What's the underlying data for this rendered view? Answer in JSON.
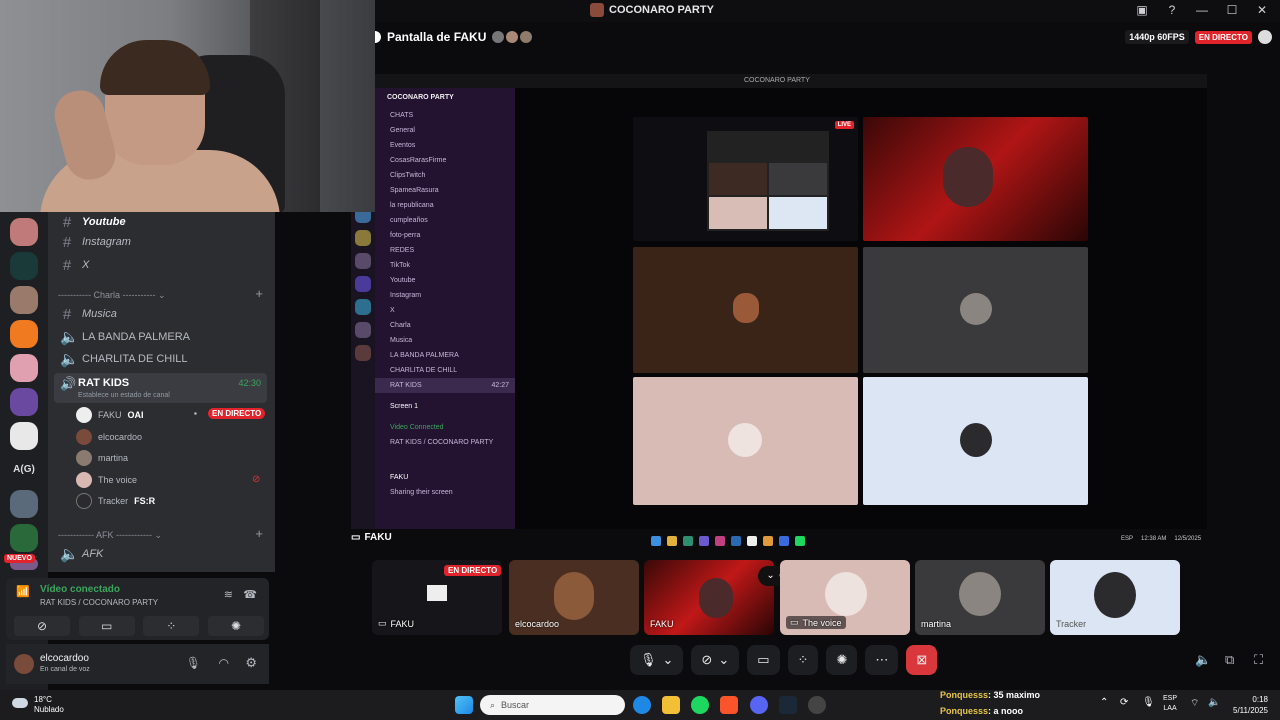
{
  "window": {
    "title": "COCONARO PARTY",
    "stream_title": "Pantalla de FAKU",
    "quality": "1440p 60FPS",
    "live_badge": "EN DIRECTO"
  },
  "inner_screen": {
    "title": "COCONARO PARTY",
    "server_name": "COCONARO PARTY",
    "channels": [
      "CHATS",
      "General",
      "Eventos",
      "CosasRarasFirme",
      "ClipsTwitch",
      "SpameaRasura",
      "la republicana",
      "cumpleaños",
      "foto-perra",
      "REDES",
      "TikTok",
      "Youtube",
      "Instagram",
      "X",
      "Charla",
      "Musica",
      "LA BANDA PALMERA",
      "CHARLITA DE CHILL",
      "RAT KIDS",
      "Screen 1",
      "Video Connected",
      "RAT KIDS / COCONARO PARTY",
      "FAKU",
      "Sharing their screen"
    ],
    "rat_kids_time": "42:27",
    "bottom_label": "FAKU",
    "tile_live": "LIVE",
    "tray_lang": "ESP",
    "tray_time": "12:38 AM",
    "tray_date": "12/5/2025"
  },
  "sidebar": {
    "channels": {
      "youtube": "Youtube",
      "instagram": "Instagram",
      "x": "X",
      "charla_category": "Charla",
      "musica": "Musica",
      "banda": "LA BANDA PALMERA",
      "charlita": "CHARLITA DE CHILL",
      "ratkids": "RAT KIDS",
      "ratkids_time": "42:30",
      "ratkids_status": "Establece un estado de canal",
      "afk_category": "AFK",
      "afk": "AFK"
    },
    "users": [
      {
        "name": "FAKU",
        "tag": "OAI",
        "badge": "EN DIRECTO"
      },
      {
        "name": "elcocardoo"
      },
      {
        "name": "martina"
      },
      {
        "name": "The voice"
      },
      {
        "name": "Tracker",
        "tag": "FS:R"
      }
    ],
    "server_label": "A(G)",
    "nuevo": "NUEVO",
    "voice": {
      "status": "Vídeo conectado",
      "sub": "RAT KIDS / COCONARO PARTY"
    },
    "user": {
      "name": "elcocardoo",
      "status": "En canal de voz"
    }
  },
  "participants": [
    {
      "name": "FAKU",
      "badge": "EN DIRECTO"
    },
    {
      "name": "elcocardoo"
    },
    {
      "name": "FAKU"
    },
    {
      "name": "The voice"
    },
    {
      "name": "martina"
    },
    {
      "name": "Tracker"
    }
  ],
  "taskbar": {
    "weather_temp": "18°C",
    "weather_desc": "Nublado",
    "search": "Buscar",
    "chat1_name": "Ponquesss",
    "chat1_text": ": 35 maximo",
    "chat2_name": "Ponquesss",
    "chat2_text": ": a nooo",
    "lang1": "ESP",
    "lang2": "LAA",
    "time": "0:18",
    "date": "5/11/2025"
  }
}
